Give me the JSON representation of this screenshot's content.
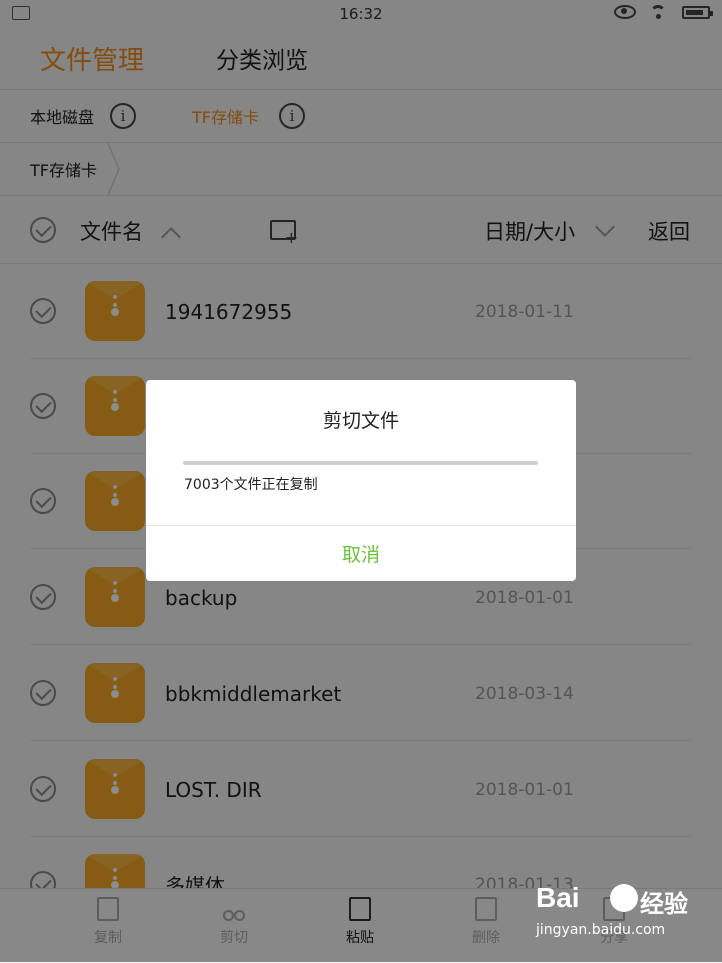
{
  "status_bar": {
    "time": "16:32"
  },
  "top_tabs": {
    "active": "文件管理",
    "inactive": "分类浏览"
  },
  "storage": {
    "local": "本地磁盘",
    "tf": "TF存储卡",
    "info_glyph": "i"
  },
  "breadcrumb": {
    "current": "TF存储卡"
  },
  "list_header": {
    "name": "文件名",
    "date_size": "日期/大小",
    "back": "返回"
  },
  "rows": [
    {
      "name": "1941672955",
      "date": "2018-01-11"
    },
    {
      "name": "",
      "date": ""
    },
    {
      "name": "",
      "date": ""
    },
    {
      "name": "backup",
      "date": "2018-01-01"
    },
    {
      "name": "bbkmiddlemarket",
      "date": "2018-03-14"
    },
    {
      "name": "LOST. DIR",
      "date": "2018-01-01"
    },
    {
      "name": "多媒体",
      "date": "2018-01-13"
    }
  ],
  "bottom_bar": {
    "copy": "复制",
    "cut": "剪切",
    "paste": "粘贴",
    "delete": "删除",
    "more": "分享"
  },
  "dialog": {
    "title": "剪切文件",
    "status": "7003个文件正在复制",
    "progress": 0,
    "cancel": "取消"
  },
  "watermark": {
    "brand": "Bai",
    "brand_cn": "经验",
    "url": "jingyan.baidu.com"
  },
  "colors": {
    "accent": "#f08a1a",
    "folder": "#f5a623",
    "dialog_button": "#6cc23c"
  }
}
